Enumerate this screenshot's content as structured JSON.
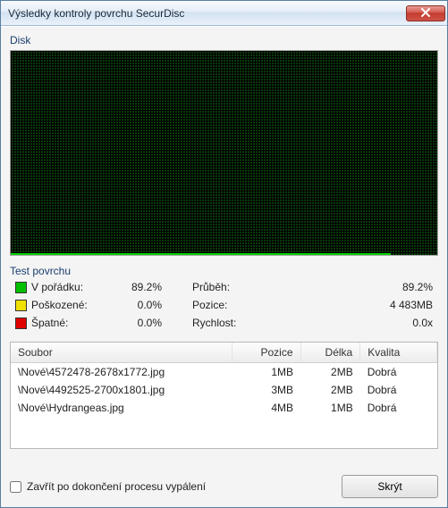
{
  "window": {
    "title": "Výsledky kontroly povrchu SecurDisc"
  },
  "disk": {
    "label": "Disk",
    "progressPercent": 89.2
  },
  "surfaceTest": {
    "title": "Test povrchu",
    "rows": {
      "ok": {
        "label": "V pořádku:",
        "value": "89.2%"
      },
      "dmg": {
        "label": "Poškozené:",
        "value": "0.0%"
      },
      "bad": {
        "label": "Špatné:",
        "value": "0.0%"
      }
    },
    "right": {
      "progress": {
        "label": "Průběh:",
        "value": "89.2%"
      },
      "position": {
        "label": "Pozice:",
        "value": "4 483MB"
      },
      "speed": {
        "label": "Rychlost:",
        "value": "0.0x"
      }
    }
  },
  "table": {
    "headers": {
      "file": "Soubor",
      "pos": "Pozice",
      "len": "Délka",
      "qual": "Kvalita"
    },
    "rows": [
      {
        "file": "\\Nové\\4572478-2678x1772.jpg",
        "pos": "1MB",
        "len": "2MB",
        "qual": "Dobrá"
      },
      {
        "file": "\\Nové\\4492525-2700x1801.jpg",
        "pos": "3MB",
        "len": "2MB",
        "qual": "Dobrá"
      },
      {
        "file": "\\Nové\\Hydrangeas.jpg",
        "pos": "4MB",
        "len": "1MB",
        "qual": "Dobrá"
      }
    ]
  },
  "footer": {
    "closeAfterBurnLabel": "Zavřít po dokončení procesu vypálení",
    "hideButton": "Skrýt"
  }
}
